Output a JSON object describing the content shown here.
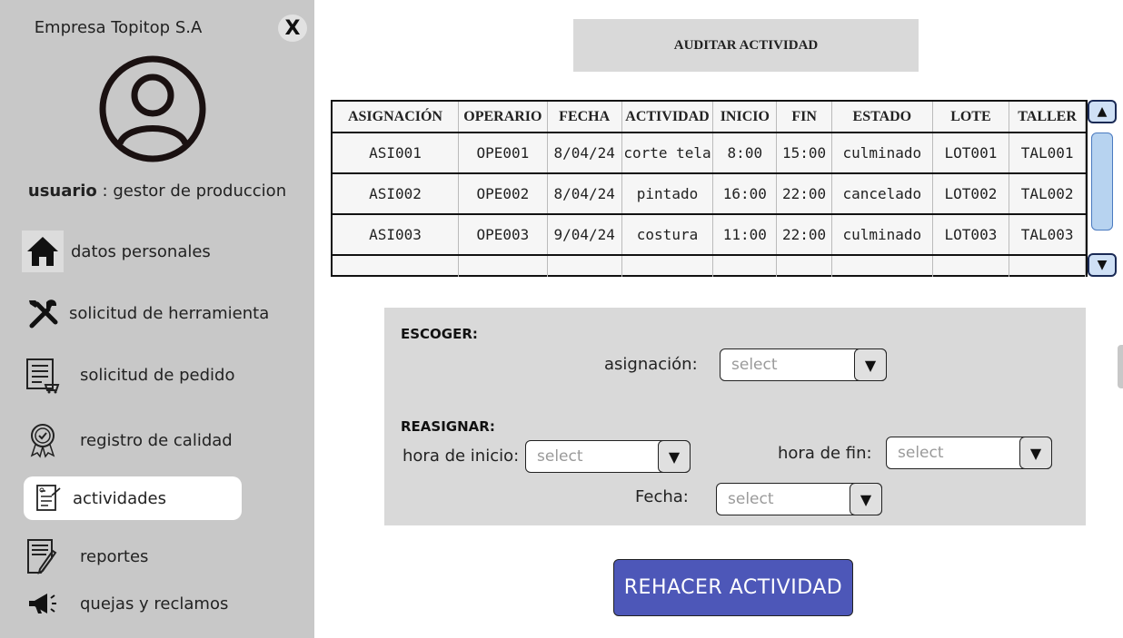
{
  "sidebar": {
    "company": "Empresa Topitop S.A",
    "close_label": "X",
    "user_label": "usuario",
    "user_role": ": gestor de produccion",
    "items": [
      {
        "label": "datos personales",
        "icon": "home-icon"
      },
      {
        "label": "solicitud de herramienta",
        "icon": "tools-icon"
      },
      {
        "label": "solicitud de pedido",
        "icon": "cart-list-icon"
      },
      {
        "label": "registro de calidad",
        "icon": "quality-badge-icon"
      },
      {
        "label": "actividades",
        "icon": "activity-doc-icon"
      },
      {
        "label": "reportes",
        "icon": "report-edit-icon"
      },
      {
        "label": "quejas y reclamos",
        "icon": "megaphone-icon"
      }
    ]
  },
  "main": {
    "title": "AUDITAR ACTIVIDAD",
    "table": {
      "headers": [
        "ASIGNACIÓN",
        "OPERARIO",
        "FECHA",
        "ACTIVIDAD",
        "INICIO",
        "FIN",
        "ESTADO",
        "LOTE",
        "TALLER"
      ],
      "rows": [
        [
          "ASI001",
          "OPE001",
          "8/04/24",
          "corte tela",
          "8:00",
          "15:00",
          "culminado",
          "LOT001",
          "TAL001"
        ],
        [
          "ASI002",
          "OPE002",
          "8/04/24",
          "pintado",
          "16:00",
          "22:00",
          "cancelado",
          "LOT002",
          "TAL002"
        ],
        [
          "ASI003",
          "OPE003",
          "9/04/24",
          "costura",
          "11:00",
          "22:00",
          "culminado",
          "LOT003",
          "TAL003"
        ]
      ]
    },
    "form": {
      "choose_title": "ESCOGER:",
      "assignment_label": "asignación:",
      "reassign_title": "REASIGNAR:",
      "start_label": "hora de inicio:",
      "end_label": "hora de fin:",
      "date_label": "Fecha:",
      "select_placeholder": "select"
    },
    "redo_button": "REHACER ACTIVIDAD"
  },
  "colors": {
    "sidebar_bg": "#c8c8c8",
    "panel_bg": "#d9d9d9",
    "button_bg": "#4d57b8",
    "scroll_bg": "#cfe0f5"
  }
}
